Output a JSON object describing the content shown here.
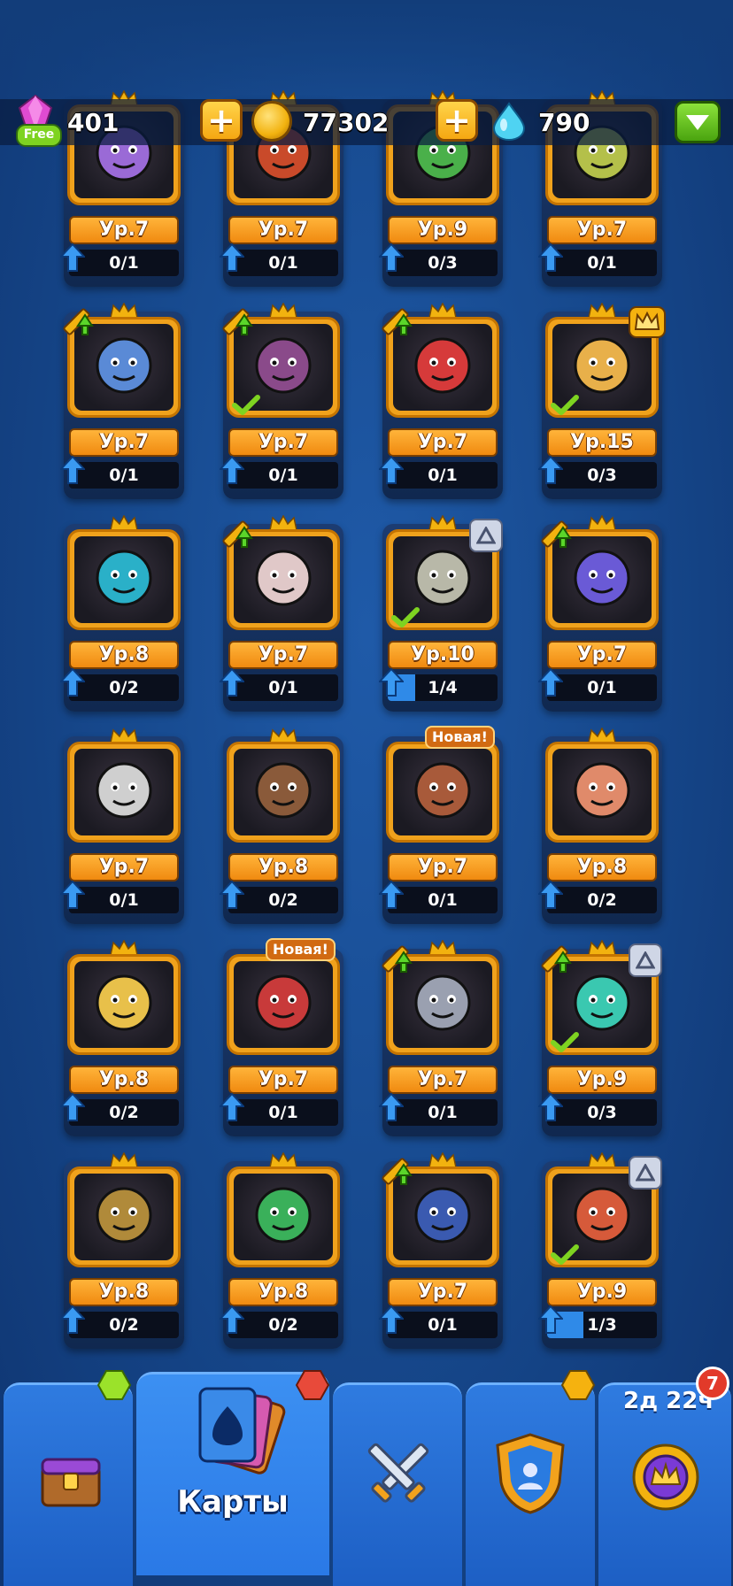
{
  "currencies": {
    "gems": "401",
    "gems_free_label": "Free",
    "gold": "77302",
    "crystals": "790"
  },
  "cards": [
    {
      "level": "Ур.7",
      "progress": "0/1",
      "fill": 0,
      "color": "#9a6ad6",
      "upgrade": false,
      "check": false,
      "badge": "none"
    },
    {
      "level": "Ур.7",
      "progress": "0/1",
      "fill": 0,
      "color": "#c94a2a",
      "upgrade": false,
      "check": false,
      "badge": "none"
    },
    {
      "level": "Ур.9",
      "progress": "0/3",
      "fill": 0,
      "color": "#4ab04a",
      "upgrade": false,
      "check": false,
      "badge": "none"
    },
    {
      "level": "Ур.7",
      "progress": "0/1",
      "fill": 0,
      "color": "#b4c04a",
      "upgrade": false,
      "check": false,
      "badge": "none"
    },
    {
      "level": "Ур.7",
      "progress": "0/1",
      "fill": 0,
      "color": "#5a8ad6",
      "upgrade": true,
      "check": false,
      "badge": "none"
    },
    {
      "level": "Ур.7",
      "progress": "0/1",
      "fill": 0,
      "color": "#8a4a8a",
      "upgrade": true,
      "check": true,
      "badge": "none"
    },
    {
      "level": "Ур.7",
      "progress": "0/1",
      "fill": 0,
      "color": "#d63a3a",
      "upgrade": true,
      "check": false,
      "badge": "none"
    },
    {
      "level": "Ур.15",
      "progress": "0/3",
      "fill": 0,
      "color": "#e8b04a",
      "upgrade": false,
      "check": true,
      "badge": "crown"
    },
    {
      "level": "Ур.8",
      "progress": "0/2",
      "fill": 0,
      "color": "#2ab0c8",
      "upgrade": false,
      "check": false,
      "badge": "none"
    },
    {
      "level": "Ур.7",
      "progress": "0/1",
      "fill": 0,
      "color": "#e0c8c8",
      "upgrade": true,
      "check": false,
      "badge": "none"
    },
    {
      "level": "Ур.10",
      "progress": "1/4",
      "fill": 0.25,
      "color": "#b8b8a8",
      "upgrade": false,
      "check": true,
      "badge": "triangle"
    },
    {
      "level": "Ур.7",
      "progress": "0/1",
      "fill": 0,
      "color": "#6a5ad6",
      "upgrade": true,
      "check": false,
      "badge": "none"
    },
    {
      "level": "Ур.7",
      "progress": "0/1",
      "fill": 0,
      "color": "#cfcfcf",
      "upgrade": false,
      "check": false,
      "badge": "none"
    },
    {
      "level": "Ур.8",
      "progress": "0/2",
      "fill": 0,
      "color": "#8a5a3a",
      "upgrade": false,
      "check": false,
      "badge": "none"
    },
    {
      "level": "Ур.7",
      "progress": "0/1",
      "fill": 0,
      "color": "#a85a3a",
      "upgrade": false,
      "check": false,
      "badge": "new"
    },
    {
      "level": "Ур.8",
      "progress": "0/2",
      "fill": 0,
      "color": "#e08a6a",
      "upgrade": false,
      "check": false,
      "badge": "none"
    },
    {
      "level": "Ур.8",
      "progress": "0/2",
      "fill": 0,
      "color": "#e8c04a",
      "upgrade": false,
      "check": false,
      "badge": "none"
    },
    {
      "level": "Ур.7",
      "progress": "0/1",
      "fill": 0,
      "color": "#c83a3a",
      "upgrade": false,
      "check": false,
      "badge": "new"
    },
    {
      "level": "Ур.7",
      "progress": "0/1",
      "fill": 0,
      "color": "#9aa0b0",
      "upgrade": true,
      "check": false,
      "badge": "none"
    },
    {
      "level": "Ур.9",
      "progress": "0/3",
      "fill": 0,
      "color": "#3ac8b0",
      "upgrade": true,
      "check": true,
      "badge": "triangle"
    },
    {
      "level": "Ур.8",
      "progress": "0/2",
      "fill": 0,
      "color": "#b08a3a",
      "upgrade": false,
      "check": false,
      "badge": "none"
    },
    {
      "level": "Ур.8",
      "progress": "0/2",
      "fill": 0,
      "color": "#3ab05a",
      "upgrade": false,
      "check": false,
      "badge": "none"
    },
    {
      "level": "Ур.7",
      "progress": "0/1",
      "fill": 0,
      "color": "#3a5ab0",
      "upgrade": true,
      "check": false,
      "badge": "none"
    },
    {
      "level": "Ур.9",
      "progress": "1/3",
      "fill": 0.33,
      "color": "#d65a3a",
      "upgrade": false,
      "check": true,
      "badge": "triangle"
    }
  ],
  "new_badge_label": "Новая!",
  "nav": {
    "cards_label": "Карты",
    "timer": "2д 22ч",
    "notification_count": "7"
  }
}
